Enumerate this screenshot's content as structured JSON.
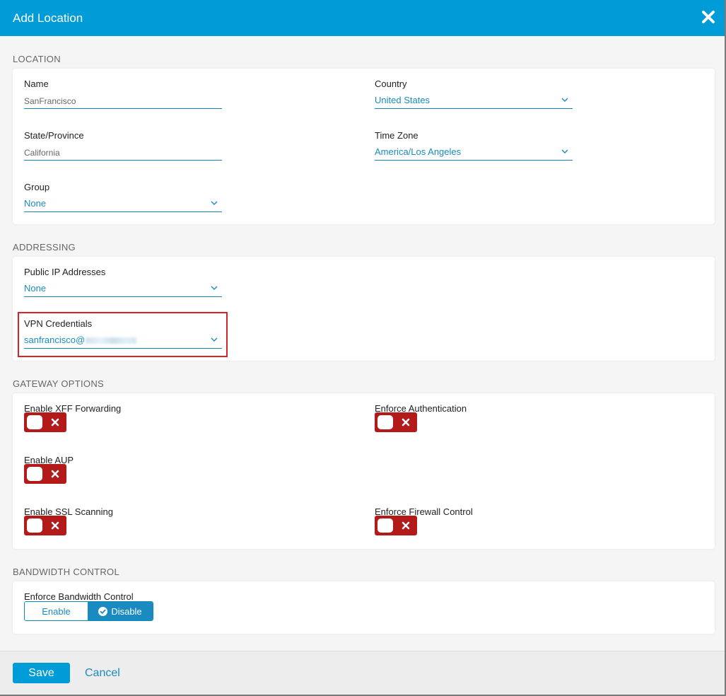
{
  "header": {
    "title": "Add Location",
    "close_icon": "close-icon"
  },
  "location": {
    "section_title": "LOCATION",
    "name_label": "Name",
    "name_value": "SanFrancisco",
    "country_label": "Country",
    "country_value": "United States",
    "state_label": "State/Province",
    "state_value": "California",
    "timezone_label": "Time Zone",
    "timezone_value": "America/Los Angeles",
    "group_label": "Group",
    "group_value": "None"
  },
  "addressing": {
    "section_title": "ADDRESSING",
    "public_ip_label": "Public IP Addresses",
    "public_ip_value": "None",
    "vpn_label": "VPN Credentials",
    "vpn_value": "sanfrancisco@"
  },
  "gateway": {
    "section_title": "GATEWAY OPTIONS",
    "xff_label": "Enable XFF Forwarding",
    "xff_enabled": false,
    "auth_label": "Enforce Authentication",
    "auth_enabled": false,
    "aup_label": "Enable AUP",
    "aup_enabled": false,
    "ssl_label": "Enable SSL Scanning",
    "ssl_enabled": false,
    "firewall_label": "Enforce Firewall Control",
    "firewall_enabled": false
  },
  "bandwidth": {
    "section_title": "BANDWIDTH CONTROL",
    "enforce_label": "Enforce Bandwidth Control",
    "enable_label": "Enable",
    "disable_label": "Disable",
    "selected": "Disable"
  },
  "footer": {
    "save_label": "Save",
    "cancel_label": "Cancel"
  },
  "colors": {
    "accent": "#009cd8",
    "link": "#1a8bc0",
    "toggle_off": "#b31b1b",
    "highlight": "#d9232a"
  }
}
